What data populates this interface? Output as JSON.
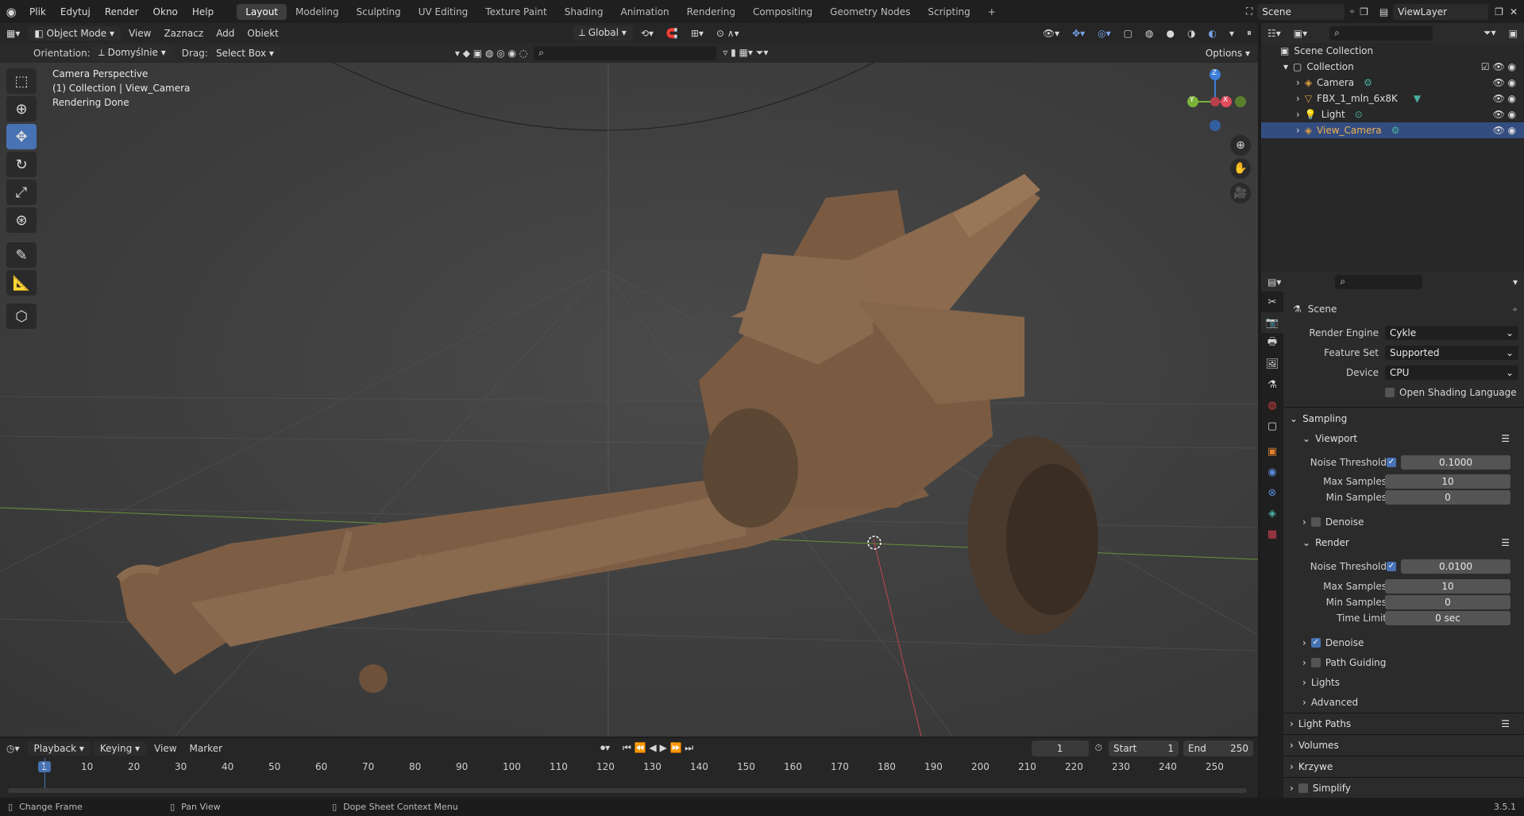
{
  "app": {
    "logo": "blender-icon",
    "version": "3.5.1"
  },
  "menu": [
    "Plik",
    "Edytuj",
    "Render",
    "Okno",
    "Help"
  ],
  "workspaces": [
    "Layout",
    "Modeling",
    "Sculpting",
    "UV Editing",
    "Texture Paint",
    "Shading",
    "Animation",
    "Rendering",
    "Compositing",
    "Geometry Nodes",
    "Scripting"
  ],
  "active_workspace": "Layout",
  "scene_field": "Scene",
  "viewlayer_field": "ViewLayer",
  "viewport_header": {
    "mode": "Object Mode",
    "menus": [
      "View",
      "Zaznacz",
      "Add",
      "Obiekt"
    ],
    "transform": "Global"
  },
  "tool_header": {
    "orientation_label": "Orientation:",
    "orientation_value": "Domyślnie",
    "drag_label": "Drag:",
    "drag_value": "Select Box",
    "options": "Options"
  },
  "viewport_info": [
    "Camera Perspective",
    "(1) Collection | View_Camera",
    "Rendering Done"
  ],
  "tools": [
    "select-box-icon",
    "cursor-icon",
    "move-icon",
    "rotate-icon",
    "scale-icon",
    "transform-icon",
    "annotate-icon",
    "measure-icon",
    "add-cube-icon"
  ],
  "active_tool": 2,
  "gizmo": {
    "x": "X",
    "y": "Y",
    "z": "Z"
  },
  "timeline": {
    "menus": [
      "Playback",
      "Keying",
      "View",
      "Marker"
    ],
    "current_frame": "1",
    "start_label": "Start",
    "start": "1",
    "end_label": "End",
    "end": "250",
    "ticks": [
      "1",
      "10",
      "20",
      "30",
      "40",
      "50",
      "60",
      "70",
      "80",
      "90",
      "100",
      "110",
      "120",
      "130",
      "140",
      "150",
      "160",
      "170",
      "180",
      "190",
      "200",
      "210",
      "220",
      "230",
      "240",
      "250"
    ]
  },
  "status": [
    "Change Frame",
    "Pan View",
    "Dope Sheet Context Menu"
  ],
  "outliner": {
    "root": "Scene Collection",
    "collection": "Collection",
    "items": [
      "Camera",
      "FBX_1_mln_6x8K",
      "Light",
      "View_Camera"
    ],
    "selected": 3
  },
  "properties": {
    "context": "Scene",
    "render_engine_label": "Render Engine",
    "render_engine": "Cykle",
    "feature_set_label": "Feature Set",
    "feature_set": "Supported",
    "device_label": "Device",
    "device": "CPU",
    "osl_label": "Open Shading Language",
    "sampling": "Sampling",
    "viewport": "Viewport",
    "noise_threshold_label": "Noise Threshold",
    "vp_noise": "0.1000",
    "max_samples_label": "Max Samples",
    "vp_max": "10",
    "min_samples_label": "Min Samples",
    "vp_min": "0",
    "denoise_label": "Denoise",
    "render": "Render",
    "r_noise": "0.0100",
    "r_max": "10",
    "r_min": "0",
    "time_limit_label": "Time Limit",
    "r_time": "0 sec",
    "path_guiding": "Path Guiding",
    "lights": "Lights",
    "advanced": "Advanced",
    "light_paths": "Light Paths",
    "volumes": "Volumes",
    "curves": "Krzywe",
    "simplify": "Simplify"
  },
  "colors": {
    "accent": "#4772b3",
    "selected": "#334d80",
    "x_axis": "#e04c5c",
    "y_axis": "#7bb33a",
    "z_axis": "#3d7ed8"
  }
}
